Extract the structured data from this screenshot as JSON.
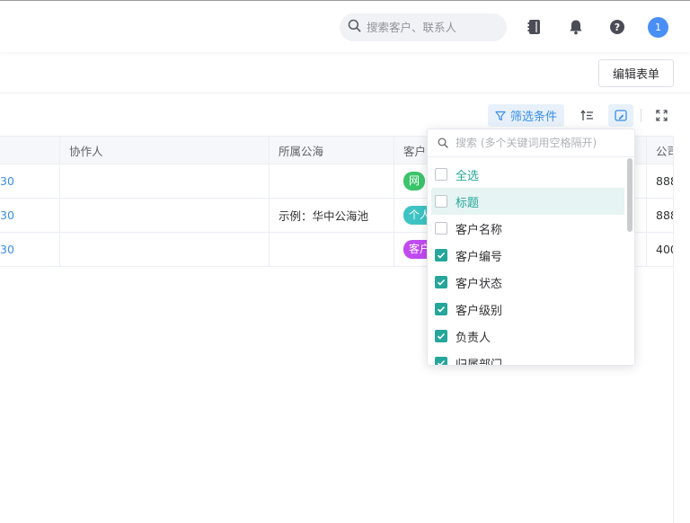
{
  "header": {
    "search_placeholder": "搜索客户、联系人",
    "avatar_text": "1"
  },
  "toolbar": {
    "edit_form_label": "编辑表单",
    "filter_label": "筛选条件"
  },
  "table": {
    "columns": [
      "协作人",
      "所属公海",
      "客户",
      "公司"
    ],
    "rows": [
      {
        "link": "30",
        "collaborator": "",
        "pool": "",
        "tag": "网",
        "tag_color": "#3bc46a",
        "company": "888"
      },
      {
        "link": "30",
        "collaborator": "",
        "pool": "示例：华中公海池",
        "tag": "个人",
        "tag_color": "#3ec3c3",
        "company": "888"
      },
      {
        "link": "30",
        "collaborator": "",
        "pool": "",
        "tag": "客户",
        "tag_color": "#c04af0",
        "company": "400"
      }
    ]
  },
  "column_picker": {
    "search_placeholder": "搜索 (多个关键词用空格隔开)",
    "select_all_label": "全选",
    "items": [
      {
        "label": "标题",
        "checked": false
      },
      {
        "label": "客户名称",
        "checked": false
      },
      {
        "label": "客户编号",
        "checked": true
      },
      {
        "label": "客户状态",
        "checked": true
      },
      {
        "label": "客户级别",
        "checked": true
      },
      {
        "label": "负责人",
        "checked": true
      },
      {
        "label": "归属部门",
        "checked": true
      }
    ]
  },
  "colors": {
    "accent": "#3a8ee6",
    "check": "#26a69a"
  }
}
